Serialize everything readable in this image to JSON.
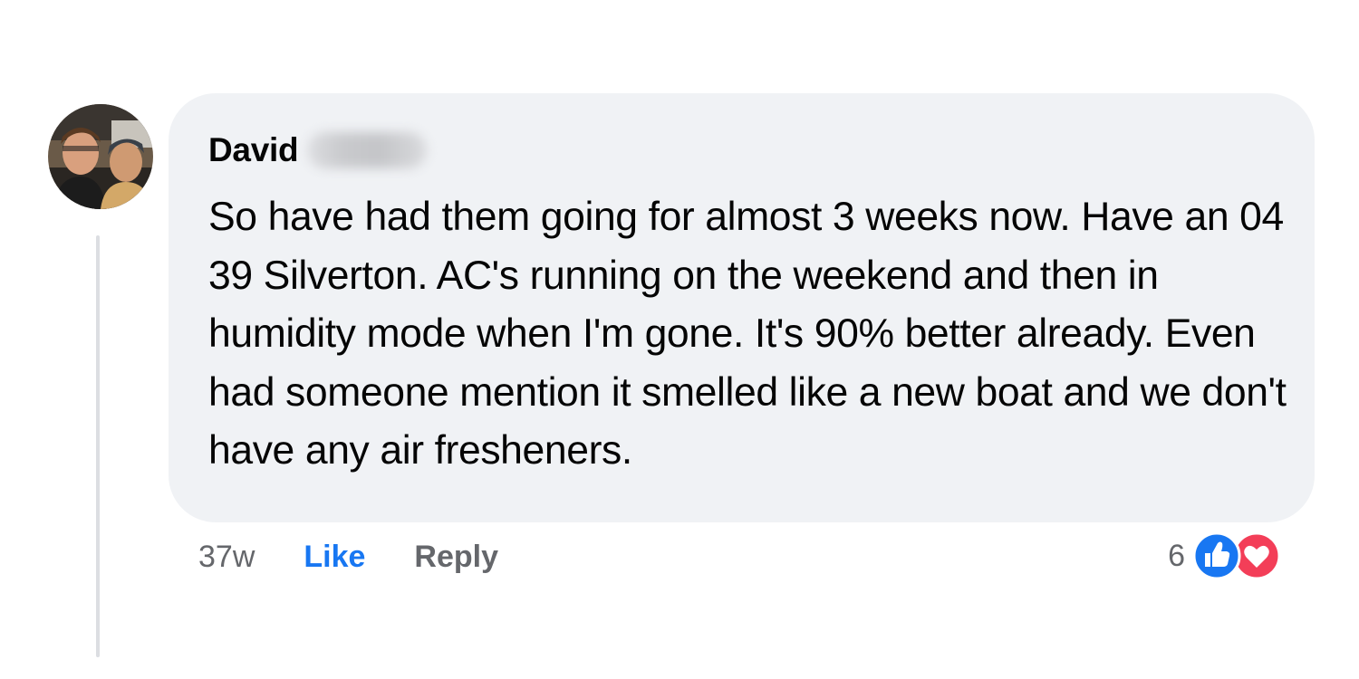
{
  "comment": {
    "author_first_name": "David",
    "text": "So have had them going for almost 3 weeks now. Have an 04 39 Silverton. AC's running on the weekend and then in humidity mode when I'm gone. It's 90% better already. Even had someone mention it smelled like a new boat and we don't have any air fresheners.",
    "timestamp": "37w",
    "like_label": "Like",
    "reply_label": "Reply",
    "reaction_count": "6",
    "reactions": [
      "like-reaction-icon",
      "love-reaction-icon"
    ]
  },
  "colors": {
    "bubble": "#f0f2f5",
    "like_blue": "#1877f2",
    "love_red": "#f33e58",
    "muted_text": "#65676b",
    "text": "#050505"
  }
}
